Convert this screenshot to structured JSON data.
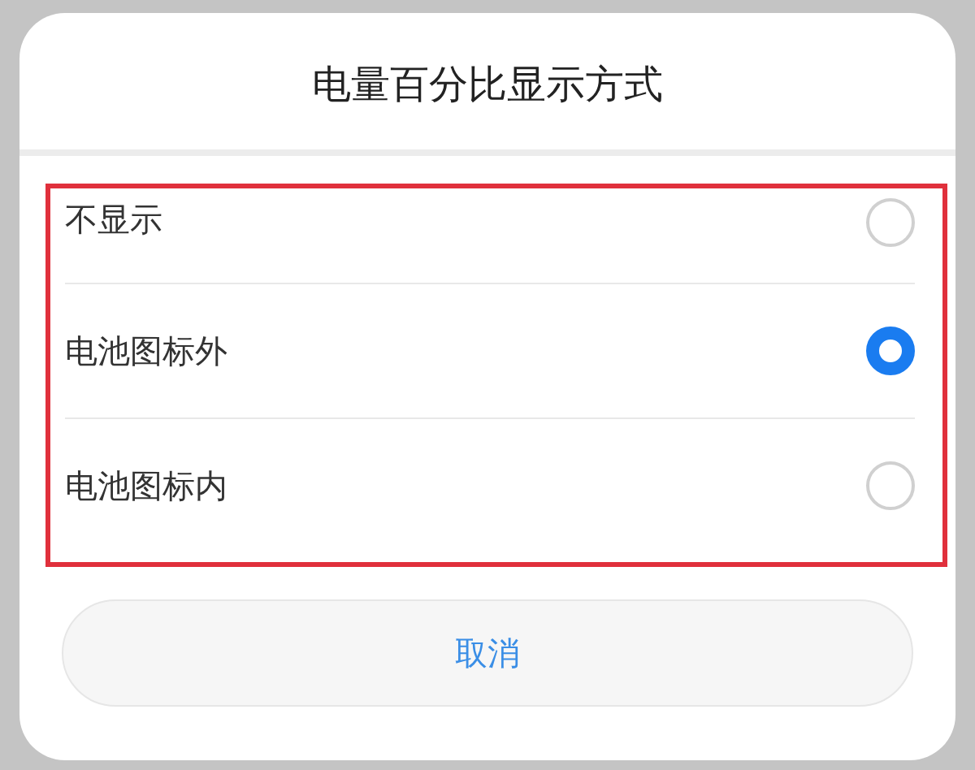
{
  "dialog": {
    "title": "电量百分比显示方式"
  },
  "options": [
    {
      "label": "不显示",
      "selected": false
    },
    {
      "label": "电池图标外",
      "selected": true
    },
    {
      "label": "电池图标内",
      "selected": false
    }
  ],
  "cancel_button": {
    "label": "取消"
  }
}
